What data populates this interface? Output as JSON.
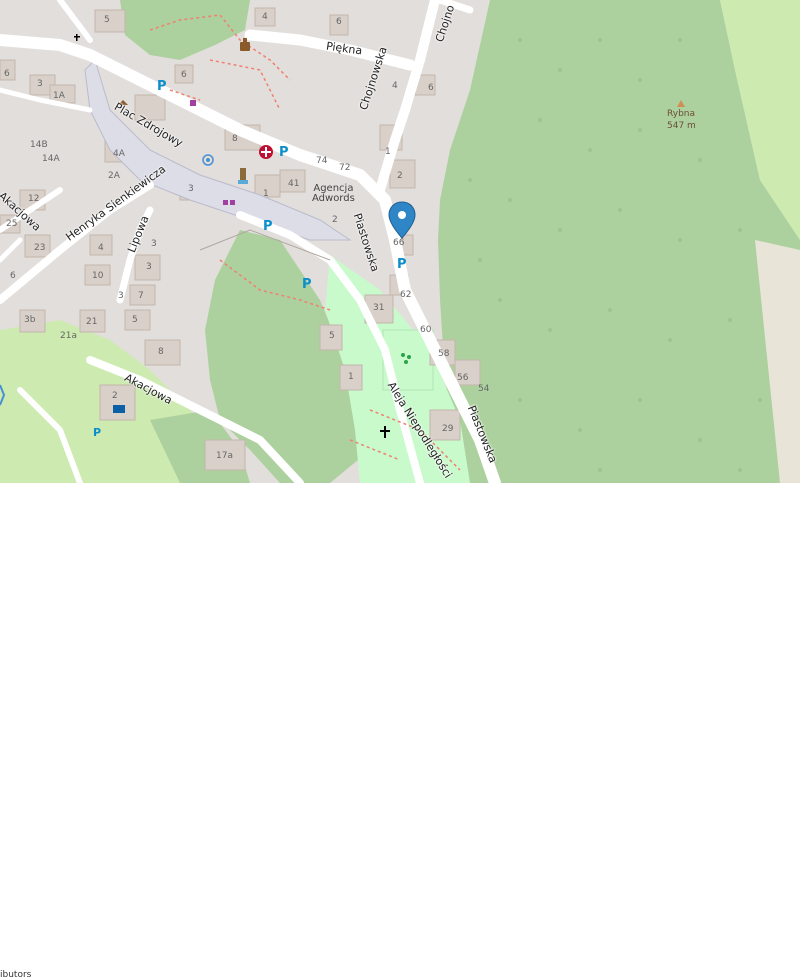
{
  "colors": {
    "background": "#e2dedc",
    "forest": "#add19e",
    "meadow": "#cdebb0",
    "park": "#c8facc",
    "building": "#d9d0c9",
    "road": "#ffffff",
    "parking_symbol": "#0b8ec9",
    "pharmacy": "#bd0f33",
    "map_pin": "#2f86c6"
  },
  "streets": {
    "piekna": "Piękna",
    "plac_zdrojowy": "Plac Zdrojowy",
    "chojnowska": "Chojnowska",
    "chojnowska_top": "Chojno",
    "piastowska": "Piastowska",
    "piastowska_south": "Piastowska",
    "henryka": "Henryka Sienkiewicza",
    "lipowa": "Lipowa",
    "akacjowa": "Akacjowa",
    "akacjowa_west": "Akacjowa",
    "aleja": "Aleja Niepodległości"
  },
  "places": {
    "agencja": "Agencja\nAdwords"
  },
  "peak": {
    "name": "Rybna",
    "elevation": "547 m"
  },
  "house_numbers": {
    "h4_top": "4",
    "h6_top": "6",
    "h5": "5",
    "h4_pieka": "4",
    "h6_a": "6",
    "h6_b": "6",
    "h3_a": "3",
    "h1A": "1A",
    "h6_c": "6",
    "h2": "2",
    "h8": "8",
    "h74": "74",
    "h72": "72",
    "h1_a": "1",
    "h14B": "14B",
    "h14A": "14A",
    "h4A": "4A",
    "h2A": "2A",
    "h12": "12",
    "h3_b": "3",
    "h1_b": "1",
    "h41": "41",
    "h2_b": "2",
    "h25": "25",
    "h23": "23",
    "h4_b": "4",
    "h10": "10",
    "h3_c": "3",
    "h7": "7",
    "h5_b": "5",
    "h3_d": "3",
    "h66": "66",
    "h62": "62",
    "h31": "31",
    "h60": "60",
    "h5_c": "5",
    "h58": "58",
    "h56": "56",
    "h54": "54",
    "h21": "21",
    "h21a": "21a",
    "h3b": "3b",
    "h8_b": "8",
    "h1_c": "1",
    "h29": "29",
    "h17a": "17a",
    "h2_c": "2",
    "h6_d": "6",
    "h3_e": "3"
  },
  "parking_label": "P",
  "attribution": "ibutors"
}
